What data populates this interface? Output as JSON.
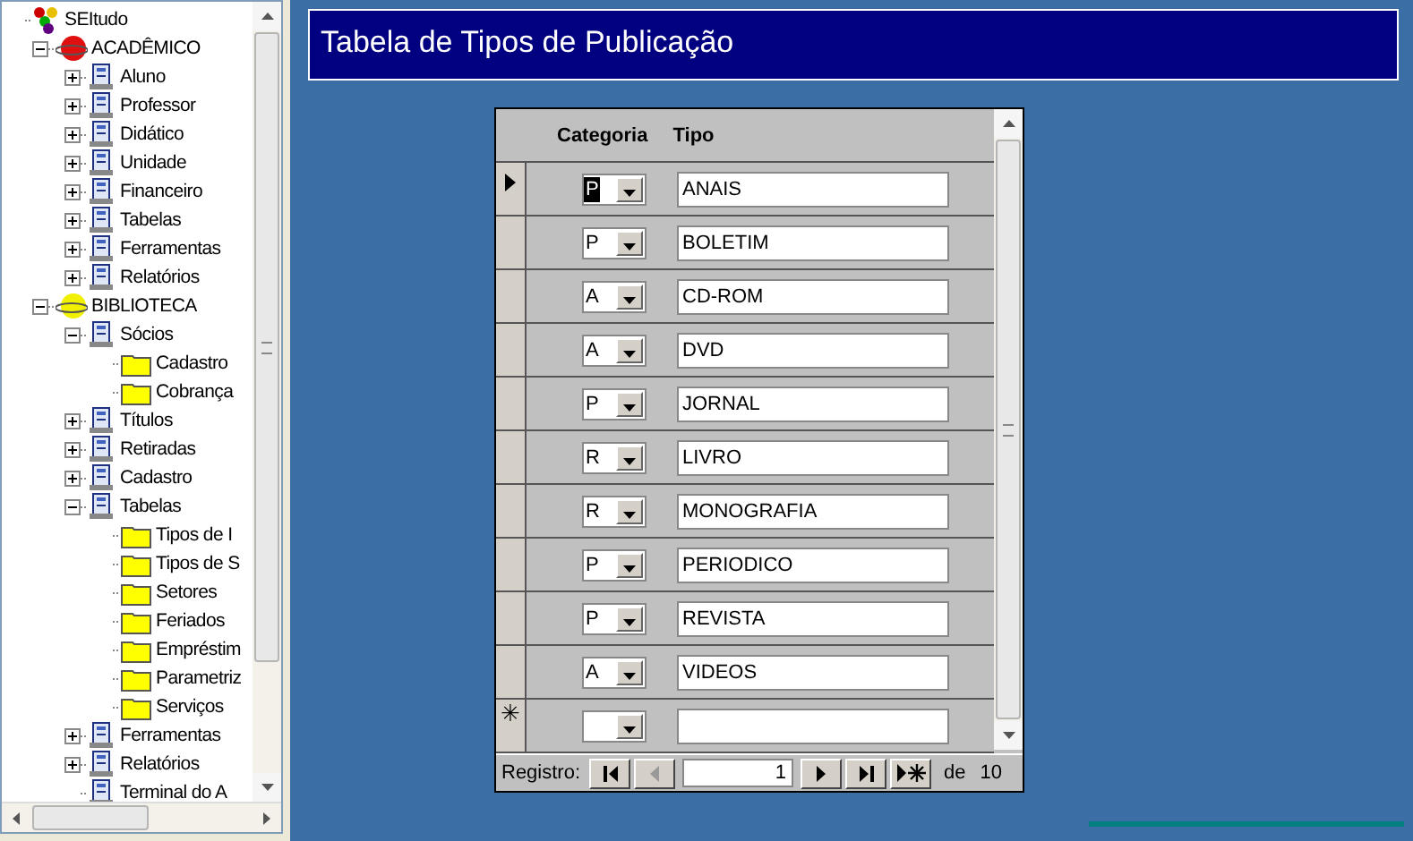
{
  "window": {
    "title": "Tabela de Tipos de Publicação"
  },
  "tree": {
    "label": "SEItudo",
    "kind": "root",
    "children": [
      {
        "label": "ACADÊMICO",
        "kind": "group",
        "color": "#e01010",
        "expanded": true,
        "children": [
          {
            "label": "Aluno",
            "kind": "module",
            "expanded": false
          },
          {
            "label": "Professor",
            "kind": "module",
            "expanded": false
          },
          {
            "label": "Didático",
            "kind": "module",
            "expanded": false
          },
          {
            "label": "Unidade",
            "kind": "module",
            "expanded": false
          },
          {
            "label": "Financeiro",
            "kind": "module",
            "expanded": false
          },
          {
            "label": "Tabelas",
            "kind": "module",
            "expanded": false
          },
          {
            "label": "Ferramentas",
            "kind": "module",
            "expanded": false
          },
          {
            "label": "Relatórios",
            "kind": "module",
            "expanded": false
          }
        ]
      },
      {
        "label": "BIBLIOTECA",
        "kind": "group",
        "color": "#f0f000",
        "expanded": true,
        "children": [
          {
            "label": "Sócios",
            "kind": "module",
            "expanded": true,
            "children": [
              {
                "label": "Cadastro",
                "kind": "folder"
              },
              {
                "label": "Cobrança",
                "kind": "folder"
              }
            ]
          },
          {
            "label": "Títulos",
            "kind": "module",
            "expanded": false
          },
          {
            "label": "Retiradas",
            "kind": "module",
            "expanded": false
          },
          {
            "label": "Cadastro",
            "kind": "module",
            "expanded": false
          },
          {
            "label": "Tabelas",
            "kind": "module",
            "expanded": true,
            "children": [
              {
                "label": "Tipos de I",
                "kind": "folder"
              },
              {
                "label": "Tipos de S",
                "kind": "folder"
              },
              {
                "label": "Setores",
                "kind": "folder"
              },
              {
                "label": "Feriados",
                "kind": "folder"
              },
              {
                "label": "Empréstim",
                "kind": "folder"
              },
              {
                "label": "Parametriz",
                "kind": "folder"
              },
              {
                "label": "Serviços",
                "kind": "folder"
              }
            ]
          },
          {
            "label": "Ferramentas",
            "kind": "module",
            "expanded": false
          },
          {
            "label": "Relatórios",
            "kind": "module",
            "expanded": false
          },
          {
            "label": "Terminal do A",
            "kind": "module"
          }
        ]
      }
    ]
  },
  "datasheet": {
    "columns": [
      "Categoria",
      "Tipo"
    ],
    "rows": [
      {
        "categoria": "P",
        "tipo": "ANAIS",
        "current": true,
        "category_selected": true
      },
      {
        "categoria": "P",
        "tipo": "BOLETIM",
        "current": false,
        "category_selected": false
      },
      {
        "categoria": "A",
        "tipo": "CD-ROM",
        "current": false,
        "category_selected": false
      },
      {
        "categoria": "A",
        "tipo": "DVD",
        "current": false,
        "category_selected": false
      },
      {
        "categoria": "P",
        "tipo": "JORNAL",
        "current": false,
        "category_selected": false
      },
      {
        "categoria": "R",
        "tipo": "LIVRO",
        "current": false,
        "category_selected": false
      },
      {
        "categoria": "R",
        "tipo": "MONOGRAFIA",
        "current": false,
        "category_selected": false
      },
      {
        "categoria": "P",
        "tipo": "PERIODICO",
        "current": false,
        "category_selected": false
      },
      {
        "categoria": "P",
        "tipo": "REVISTA",
        "current": false,
        "category_selected": false
      },
      {
        "categoria": "A",
        "tipo": "VIDEOS",
        "current": false,
        "category_selected": false
      }
    ],
    "new_row_marker": "✳"
  },
  "navigation": {
    "label": "Registro:",
    "record": "1",
    "of": "de",
    "total": "10",
    "buttons": [
      {
        "kind": "first",
        "disabled": false
      },
      {
        "kind": "previous",
        "disabled": true
      },
      {
        "kind": "next",
        "disabled": false
      },
      {
        "kind": "last",
        "disabled": false
      },
      {
        "kind": "new",
        "disabled": false
      }
    ]
  }
}
